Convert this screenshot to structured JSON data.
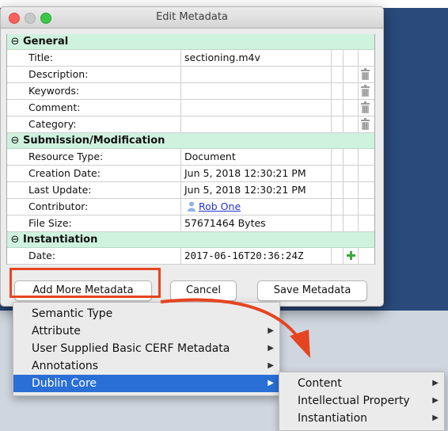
{
  "window": {
    "title": "Edit Metadata"
  },
  "sections": {
    "general": {
      "header": "General",
      "rows": [
        {
          "label": "Title:",
          "value": "sectioning.m4v",
          "trash": false
        },
        {
          "label": "Description:",
          "value": "",
          "trash": true
        },
        {
          "label": "Keywords:",
          "value": "",
          "trash": true
        },
        {
          "label": "Comment:",
          "value": "",
          "trash": true
        },
        {
          "label": "Category:",
          "value": "",
          "trash": true
        }
      ]
    },
    "submission": {
      "header": "Submission/Modification",
      "rows": [
        {
          "label": "Resource Type:",
          "value": "Document"
        },
        {
          "label": "Creation Date:",
          "value": "Jun 5, 2018 12:30:21 PM"
        },
        {
          "label": "Last Update:",
          "value": "Jun 5, 2018 12:30:21 PM"
        },
        {
          "label": "Contributor:",
          "value": "Rob One"
        },
        {
          "label": "File Size:",
          "value": "57671464 Bytes"
        }
      ]
    },
    "instantiation": {
      "header": "Instantiation",
      "rows": [
        {
          "label": "Date:",
          "value": "2017-06-16T20:36:24Z"
        }
      ]
    }
  },
  "buttons": {
    "add_more": "Add More Metadata",
    "cancel": "Cancel",
    "save": "Save Metadata"
  },
  "menu": {
    "items": [
      {
        "label": "Semantic Type",
        "submenu": false
      },
      {
        "label": "Attribute",
        "submenu": true
      },
      {
        "label": "User Supplied Basic CERF Metadata",
        "submenu": true
      },
      {
        "label": "Annotations",
        "submenu": true
      },
      {
        "label": "Dublin Core",
        "submenu": true,
        "selected": true
      }
    ]
  },
  "submenu": {
    "items": [
      {
        "label": "Content",
        "submenu": true
      },
      {
        "label": "Intellectual Property",
        "submenu": true
      },
      {
        "label": "Instantiation",
        "submenu": true
      }
    ]
  },
  "colors": {
    "section_bg": "#cff2df",
    "highlight": "#e64420",
    "selection": "#2a6fd6",
    "desktop": "#2a4a7c"
  },
  "icons": {
    "collapse": "circled-minus-icon",
    "trash": "trash-icon",
    "add": "green-plus-icon",
    "contributor": "person-icon",
    "submenu": "triangle-right-icon"
  }
}
